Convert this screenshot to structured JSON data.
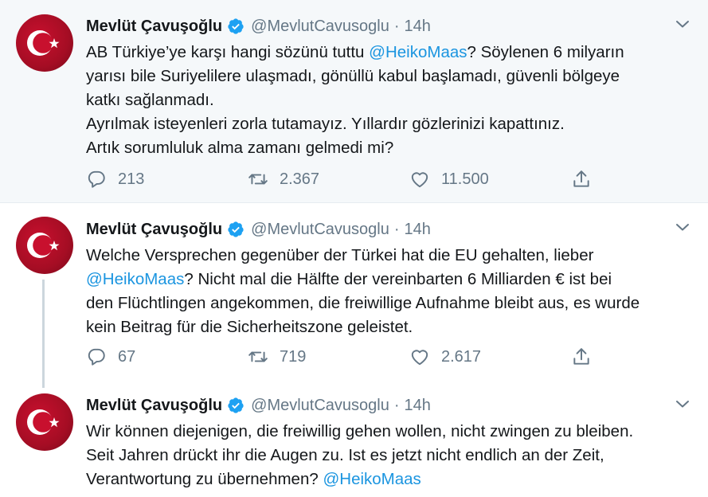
{
  "colors": {
    "link": "#1b95e0",
    "muted": "#657786",
    "text": "#14171a",
    "verified": "#1da1f2",
    "avatar_red": "#c8102e"
  },
  "tweets": [
    {
      "author_name": "Mevlüt Çavuşoğlu",
      "handle": "@MevlutCavusoglu",
      "separator": "·",
      "time": "14h",
      "avatar_icon": "turkish-flag-avatar",
      "lines": [
        {
          "before": "AB Türkiye’ye karşı hangi sözünü tuttu ",
          "mention": "@HeikoMaas",
          "after": "? Söylenen 6 milyarın"
        },
        {
          "before": "yarısı bile Suriyelilere ulaşmadı, gönüllü kabul başlamadı, güvenli bölgeye",
          "mention": "",
          "after": ""
        },
        {
          "before": "katkı sağlanmadı.",
          "mention": "",
          "after": ""
        },
        {
          "before": "Ayrılmak isteyenleri zorla tutamayız. Yıllardır gözlerinizi kapattınız.",
          "mention": "",
          "after": ""
        },
        {
          "before": "Artık sorumluluk alma zamanı gelmedi mi?",
          "mention": "",
          "after": ""
        }
      ],
      "replies": "213",
      "retweets": "2.367",
      "likes": "11.500"
    },
    {
      "author_name": "Mevlüt Çavuşoğlu",
      "handle": "@MevlutCavusoglu",
      "separator": "·",
      "time": "14h",
      "avatar_icon": "turkish-flag-avatar",
      "lines": [
        {
          "before": "Welche Versprechen gegenüber der Türkei hat die EU gehalten, lieber",
          "mention": "",
          "after": ""
        },
        {
          "before": "",
          "mention": "@HeikoMaas",
          "after": "? Nicht mal die Hälfte der vereinbarten 6 Milliarden € ist bei"
        },
        {
          "before": "den Flüchtlingen angekommen, die freiwillige Aufnahme bleibt aus, es wurde",
          "mention": "",
          "after": ""
        },
        {
          "before": "kein Beitrag für die Sicherheitszone geleistet.",
          "mention": "",
          "after": ""
        }
      ],
      "replies": "67",
      "retweets": "719",
      "likes": "2.617"
    },
    {
      "author_name": "Mevlüt Çavuşoğlu",
      "handle": "@MevlutCavusoglu",
      "separator": "·",
      "time": "14h",
      "avatar_icon": "turkish-flag-avatar",
      "lines": [
        {
          "before": "Wir können diejenigen, die freiwillig gehen wollen, nicht zwingen zu bleiben.",
          "mention": "",
          "after": ""
        },
        {
          "before": "Seit Jahren drückt ihr die Augen zu. Ist es jetzt nicht endlich an der Zeit,",
          "mention": "",
          "after": ""
        },
        {
          "before": "Verantwortung zu übernehmen? ",
          "mention": "@HeikoMaas",
          "after": ""
        }
      ]
    }
  ]
}
